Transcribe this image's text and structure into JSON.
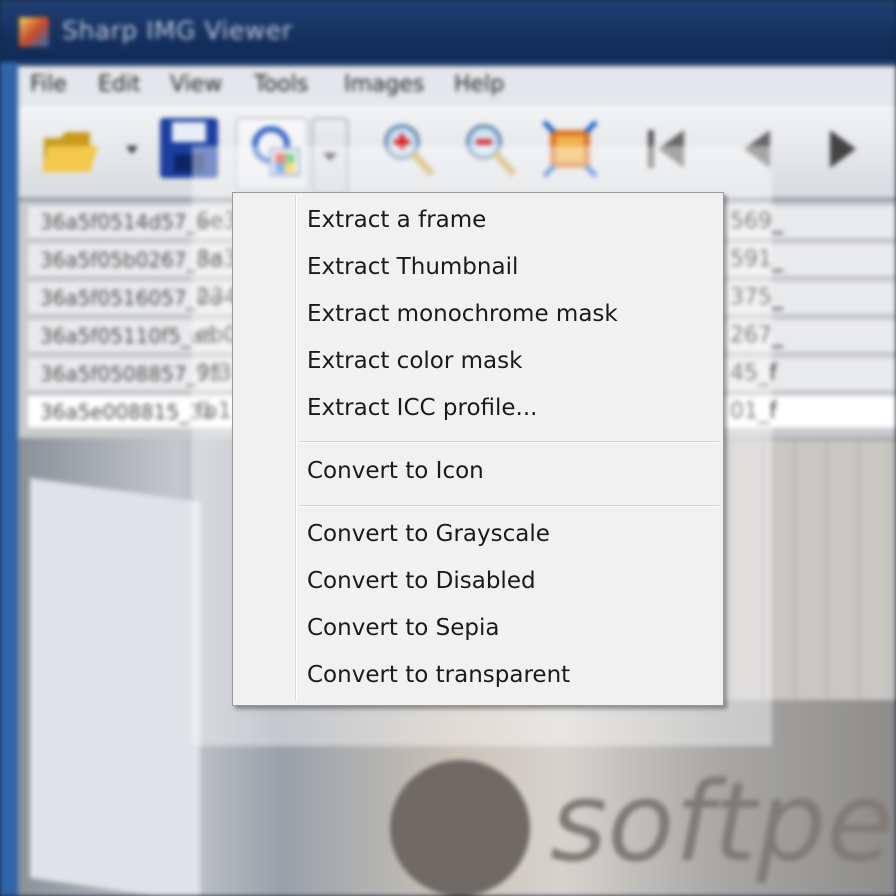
{
  "window": {
    "title": "Sharp IMG Viewer"
  },
  "menubar": {
    "items": [
      "File",
      "Edit",
      "View",
      "Tools",
      "Images",
      "Help"
    ]
  },
  "toolbar": {
    "icons": [
      "folder-icon",
      "save-icon",
      "convert-icon",
      "dropdown-arrow-icon",
      "zoom-in-icon",
      "zoom-out-icon",
      "fit-icon",
      "first-icon",
      "prev-icon",
      "next-icon"
    ]
  },
  "filelist": {
    "rows": [
      {
        "mid": "6e3",
        "right": "569_"
      },
      {
        "mid": "8a3",
        "right": "591_"
      },
      {
        "mid": "234",
        "right": "375_"
      },
      {
        "mid": "eb0",
        "right": "267_"
      },
      {
        "mid": "9f3",
        "right": "45_f"
      },
      {
        "mid": "fb1",
        "right": "01_f"
      }
    ]
  },
  "watermark": {
    "text": "softpe"
  },
  "context_menu": {
    "groups": [
      [
        "Extract a frame",
        "Extract Thumbnail",
        "Extract monochrome mask",
        "Extract color mask",
        "Extract ICC profile..."
      ],
      [
        "Convert to Icon"
      ],
      [
        "Convert to Grayscale",
        "Convert to Disabled",
        "Convert to Sepia",
        "Convert to transparent"
      ]
    ]
  }
}
